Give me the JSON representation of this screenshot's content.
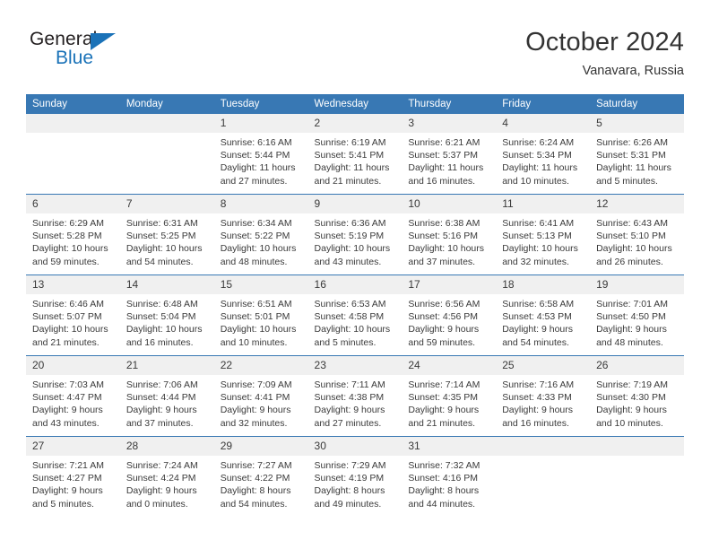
{
  "brand": {
    "name_part1": "General",
    "name_part2": "Blue",
    "color_dark": "#231f20",
    "color_blue": "#1a72b8"
  },
  "header": {
    "title": "October 2024",
    "location": "Vanavara, Russia"
  },
  "theme": {
    "header_row_bg": "#3878b4",
    "daynum_bg": "#f0f0f0",
    "text": "#3a3a3a"
  },
  "weekdays": [
    "Sunday",
    "Monday",
    "Tuesday",
    "Wednesday",
    "Thursday",
    "Friday",
    "Saturday"
  ],
  "weeks": [
    [
      {
        "day": "",
        "sunrise": "",
        "sunset": "",
        "daylight1": "",
        "daylight2": ""
      },
      {
        "day": "",
        "sunrise": "",
        "sunset": "",
        "daylight1": "",
        "daylight2": ""
      },
      {
        "day": "1",
        "sunrise": "Sunrise: 6:16 AM",
        "sunset": "Sunset: 5:44 PM",
        "daylight1": "Daylight: 11 hours",
        "daylight2": "and 27 minutes."
      },
      {
        "day": "2",
        "sunrise": "Sunrise: 6:19 AM",
        "sunset": "Sunset: 5:41 PM",
        "daylight1": "Daylight: 11 hours",
        "daylight2": "and 21 minutes."
      },
      {
        "day": "3",
        "sunrise": "Sunrise: 6:21 AM",
        "sunset": "Sunset: 5:37 PM",
        "daylight1": "Daylight: 11 hours",
        "daylight2": "and 16 minutes."
      },
      {
        "day": "4",
        "sunrise": "Sunrise: 6:24 AM",
        "sunset": "Sunset: 5:34 PM",
        "daylight1": "Daylight: 11 hours",
        "daylight2": "and 10 minutes."
      },
      {
        "day": "5",
        "sunrise": "Sunrise: 6:26 AM",
        "sunset": "Sunset: 5:31 PM",
        "daylight1": "Daylight: 11 hours",
        "daylight2": "and 5 minutes."
      }
    ],
    [
      {
        "day": "6",
        "sunrise": "Sunrise: 6:29 AM",
        "sunset": "Sunset: 5:28 PM",
        "daylight1": "Daylight: 10 hours",
        "daylight2": "and 59 minutes."
      },
      {
        "day": "7",
        "sunrise": "Sunrise: 6:31 AM",
        "sunset": "Sunset: 5:25 PM",
        "daylight1": "Daylight: 10 hours",
        "daylight2": "and 54 minutes."
      },
      {
        "day": "8",
        "sunrise": "Sunrise: 6:34 AM",
        "sunset": "Sunset: 5:22 PM",
        "daylight1": "Daylight: 10 hours",
        "daylight2": "and 48 minutes."
      },
      {
        "day": "9",
        "sunrise": "Sunrise: 6:36 AM",
        "sunset": "Sunset: 5:19 PM",
        "daylight1": "Daylight: 10 hours",
        "daylight2": "and 43 minutes."
      },
      {
        "day": "10",
        "sunrise": "Sunrise: 6:38 AM",
        "sunset": "Sunset: 5:16 PM",
        "daylight1": "Daylight: 10 hours",
        "daylight2": "and 37 minutes."
      },
      {
        "day": "11",
        "sunrise": "Sunrise: 6:41 AM",
        "sunset": "Sunset: 5:13 PM",
        "daylight1": "Daylight: 10 hours",
        "daylight2": "and 32 minutes."
      },
      {
        "day": "12",
        "sunrise": "Sunrise: 6:43 AM",
        "sunset": "Sunset: 5:10 PM",
        "daylight1": "Daylight: 10 hours",
        "daylight2": "and 26 minutes."
      }
    ],
    [
      {
        "day": "13",
        "sunrise": "Sunrise: 6:46 AM",
        "sunset": "Sunset: 5:07 PM",
        "daylight1": "Daylight: 10 hours",
        "daylight2": "and 21 minutes."
      },
      {
        "day": "14",
        "sunrise": "Sunrise: 6:48 AM",
        "sunset": "Sunset: 5:04 PM",
        "daylight1": "Daylight: 10 hours",
        "daylight2": "and 16 minutes."
      },
      {
        "day": "15",
        "sunrise": "Sunrise: 6:51 AM",
        "sunset": "Sunset: 5:01 PM",
        "daylight1": "Daylight: 10 hours",
        "daylight2": "and 10 minutes."
      },
      {
        "day": "16",
        "sunrise": "Sunrise: 6:53 AM",
        "sunset": "Sunset: 4:58 PM",
        "daylight1": "Daylight: 10 hours",
        "daylight2": "and 5 minutes."
      },
      {
        "day": "17",
        "sunrise": "Sunrise: 6:56 AM",
        "sunset": "Sunset: 4:56 PM",
        "daylight1": "Daylight: 9 hours",
        "daylight2": "and 59 minutes."
      },
      {
        "day": "18",
        "sunrise": "Sunrise: 6:58 AM",
        "sunset": "Sunset: 4:53 PM",
        "daylight1": "Daylight: 9 hours",
        "daylight2": "and 54 minutes."
      },
      {
        "day": "19",
        "sunrise": "Sunrise: 7:01 AM",
        "sunset": "Sunset: 4:50 PM",
        "daylight1": "Daylight: 9 hours",
        "daylight2": "and 48 minutes."
      }
    ],
    [
      {
        "day": "20",
        "sunrise": "Sunrise: 7:03 AM",
        "sunset": "Sunset: 4:47 PM",
        "daylight1": "Daylight: 9 hours",
        "daylight2": "and 43 minutes."
      },
      {
        "day": "21",
        "sunrise": "Sunrise: 7:06 AM",
        "sunset": "Sunset: 4:44 PM",
        "daylight1": "Daylight: 9 hours",
        "daylight2": "and 37 minutes."
      },
      {
        "day": "22",
        "sunrise": "Sunrise: 7:09 AM",
        "sunset": "Sunset: 4:41 PM",
        "daylight1": "Daylight: 9 hours",
        "daylight2": "and 32 minutes."
      },
      {
        "day": "23",
        "sunrise": "Sunrise: 7:11 AM",
        "sunset": "Sunset: 4:38 PM",
        "daylight1": "Daylight: 9 hours",
        "daylight2": "and 27 minutes."
      },
      {
        "day": "24",
        "sunrise": "Sunrise: 7:14 AM",
        "sunset": "Sunset: 4:35 PM",
        "daylight1": "Daylight: 9 hours",
        "daylight2": "and 21 minutes."
      },
      {
        "day": "25",
        "sunrise": "Sunrise: 7:16 AM",
        "sunset": "Sunset: 4:33 PM",
        "daylight1": "Daylight: 9 hours",
        "daylight2": "and 16 minutes."
      },
      {
        "day": "26",
        "sunrise": "Sunrise: 7:19 AM",
        "sunset": "Sunset: 4:30 PM",
        "daylight1": "Daylight: 9 hours",
        "daylight2": "and 10 minutes."
      }
    ],
    [
      {
        "day": "27",
        "sunrise": "Sunrise: 7:21 AM",
        "sunset": "Sunset: 4:27 PM",
        "daylight1": "Daylight: 9 hours",
        "daylight2": "and 5 minutes."
      },
      {
        "day": "28",
        "sunrise": "Sunrise: 7:24 AM",
        "sunset": "Sunset: 4:24 PM",
        "daylight1": "Daylight: 9 hours",
        "daylight2": "and 0 minutes."
      },
      {
        "day": "29",
        "sunrise": "Sunrise: 7:27 AM",
        "sunset": "Sunset: 4:22 PM",
        "daylight1": "Daylight: 8 hours",
        "daylight2": "and 54 minutes."
      },
      {
        "day": "30",
        "sunrise": "Sunrise: 7:29 AM",
        "sunset": "Sunset: 4:19 PM",
        "daylight1": "Daylight: 8 hours",
        "daylight2": "and 49 minutes."
      },
      {
        "day": "31",
        "sunrise": "Sunrise: 7:32 AM",
        "sunset": "Sunset: 4:16 PM",
        "daylight1": "Daylight: 8 hours",
        "daylight2": "and 44 minutes."
      },
      {
        "day": "",
        "sunrise": "",
        "sunset": "",
        "daylight1": "",
        "daylight2": ""
      },
      {
        "day": "",
        "sunrise": "",
        "sunset": "",
        "daylight1": "",
        "daylight2": ""
      }
    ]
  ]
}
